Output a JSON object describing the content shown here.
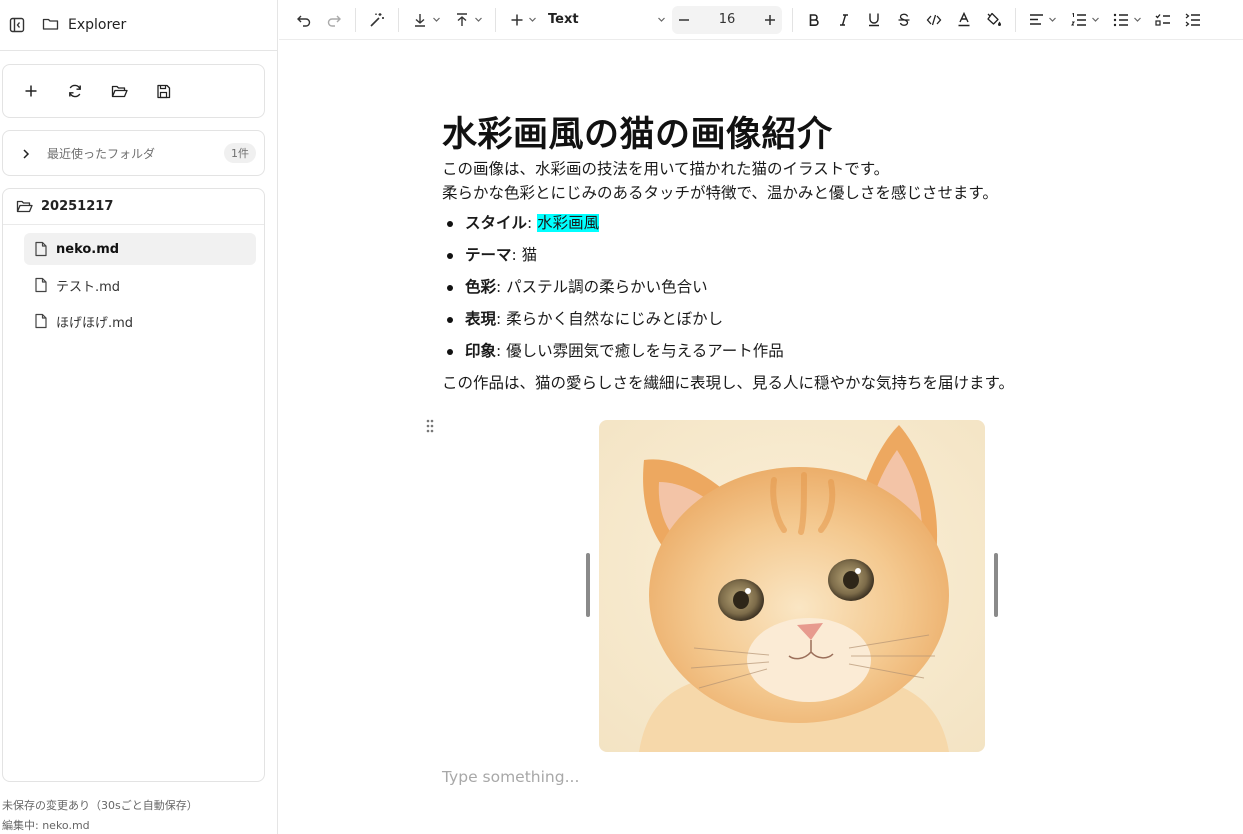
{
  "sidebar": {
    "title": "Explorer",
    "recent": {
      "label": "最近使ったフォルダ",
      "count": "1件"
    },
    "folder": {
      "name": "20251217"
    },
    "files": [
      {
        "name": "neko.md",
        "active": true
      },
      {
        "name": "テスト.md",
        "active": false
      },
      {
        "name": "ほげほげ.md",
        "active": false
      }
    ],
    "status_unsaved": "未保存の変更あり（30sごと自動保存）",
    "status_editing": "編集中: neko.md"
  },
  "toolbar": {
    "block_type": "Text",
    "font_size": "16"
  },
  "document": {
    "title": "水彩画風の猫の画像紹介",
    "intro_line1": "この画像は、水彩画の技法を用いて描かれた猫のイラストです。",
    "intro_line2": "柔らかな色彩とにじみのあるタッチが特徴で、温かみと優しさを感じさせます。",
    "points": [
      {
        "key": "スタイル",
        "sep": ": ",
        "value": "水彩画風",
        "highlight": true
      },
      {
        "key": "テーマ",
        "sep": ": ",
        "value": "猫"
      },
      {
        "key": "色彩",
        "sep": ": ",
        "value": "パステル調の柔らかい色合い"
      },
      {
        "key": "表現",
        "sep": ": ",
        "value": "柔らかく自然なにじみとぼかし"
      },
      {
        "key": "印象",
        "sep": ": ",
        "value": "優しい雰囲気で癒しを与えるアート作品"
      }
    ],
    "outro": "この作品は、猫の愛らしさを繊細に表現し、見る人に穏やかな気持ちを届けます。",
    "placeholder": "Type something..."
  },
  "icons": {
    "sidebar_toggle": "sidebar-toggle-icon",
    "explorer": "folder-icon",
    "actions": [
      "plus-icon",
      "refresh-icon",
      "folder-open-icon",
      "save-icon"
    ],
    "file": "file-icon",
    "toolbar": [
      "undo-icon",
      "redo-icon",
      "magic-wand-icon",
      "insert-below-icon",
      "insert-above-icon",
      "plus-icon",
      "minus-icon",
      "plus-icon",
      "bold-icon",
      "italic-icon",
      "underline-icon",
      "strikethrough-icon",
      "code-icon",
      "text-color-icon",
      "highlight-color-icon",
      "align-left-icon",
      "ordered-list-icon",
      "bullet-list-icon",
      "task-list-icon",
      "numbered-list-icon"
    ]
  },
  "colors": {
    "highlight": "#00ffff",
    "active_file_bg": "#f1f1f1"
  }
}
